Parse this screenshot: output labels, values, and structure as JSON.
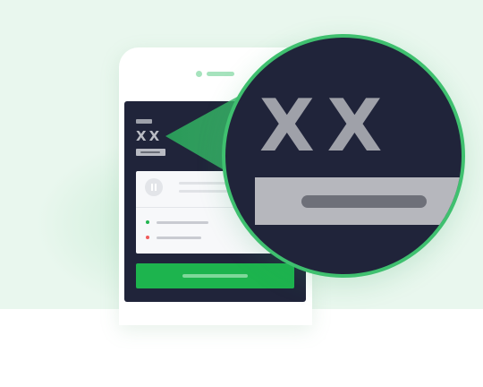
{
  "illustration": {
    "mini_code": "XX",
    "zoom_code": "XX"
  },
  "colors": {
    "background": "#e9f7ee",
    "screen": "#20243a",
    "accent_green": "#1db44e",
    "ring_green": "#3fc06f",
    "status_ok": "#22b550",
    "status_error": "#f05a5a"
  },
  "icons": [
    "pause-icon",
    "status-dot-green",
    "status-dot-red",
    "magnifier-circle"
  ]
}
